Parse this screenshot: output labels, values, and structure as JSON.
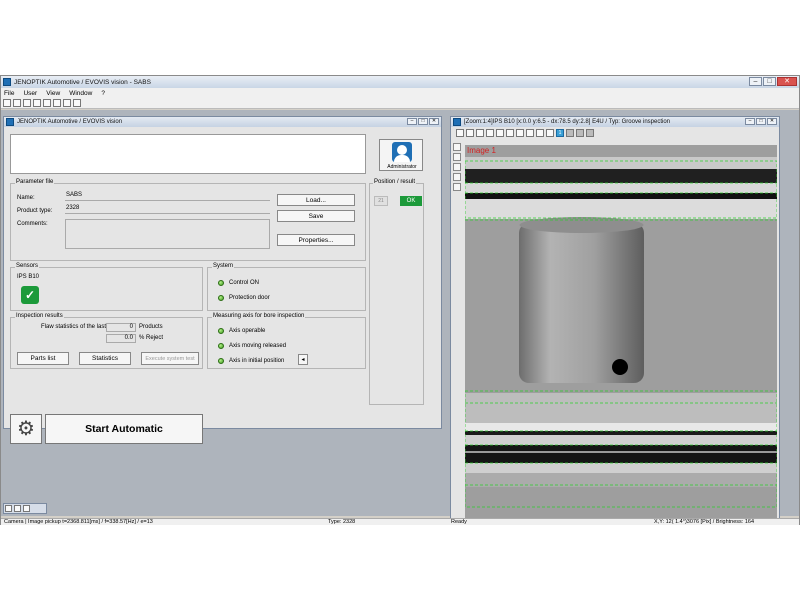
{
  "app": {
    "title": "JENOPTIK Automotive / EVOVIS vision - SABS"
  },
  "menu": [
    "File",
    "User",
    "View",
    "Window",
    "?"
  ],
  "main_window": {
    "title": "JENOPTIK Automotive / EVOVIS vision",
    "admin_label": "Administrator",
    "parameter_file": {
      "group_label": "Parameter file",
      "name_label": "Name:",
      "name_value": "SABS",
      "product_type_label": "Product type:",
      "product_type_value": "2328",
      "comments_label": "Comments:",
      "load_button": "Load...",
      "save_button": "Save",
      "properties_button": "Properties..."
    },
    "position_result": {
      "group_label": "Position / result",
      "position_value": "21",
      "result": "OK"
    },
    "sensors": {
      "group_label": "Sensors",
      "sensor_name": "IPS B10"
    },
    "system": {
      "group_label": "System",
      "items": [
        "Control ON",
        "Protection door"
      ]
    },
    "inspection_results": {
      "group_label": "Inspection results",
      "flaw_label": "Flaw statistics of the last",
      "products_value": "0",
      "products_label": "Products",
      "reject_value": "0.0",
      "reject_label": "% Reject",
      "parts_list_button": "Parts list",
      "statistics_button": "Statistics",
      "execute_system_test_button": "Execute system test"
    },
    "measuring_axis": {
      "group_label": "Measuring axis for bore inspection",
      "items": [
        "Axis operable",
        "Axis moving released",
        "Axis in initial position"
      ]
    },
    "start_button": "Start Automatic"
  },
  "image_window": {
    "title": "[Zoom:1:4]IPS B10  [x:0.0 y:6.5 - dx:78.5 dy:2.8]  E4U / Typ: Groove inspection",
    "image_label": "Image 1",
    "toolbar_selected": "1"
  },
  "status_bar": {
    "camera": "Camera | Image pickup t=2368.811[ms] / f=338.57[Hz] / e=13",
    "type": "Type: 2328",
    "state": "Ready",
    "coords": "X,Y:   12( 1.4°)3076 [Pix] / Brightness: 164"
  },
  "colors": {
    "ok_green": "#1c9a3a",
    "accent_blue": "#1f6fb5",
    "overlay_green": "#2dd02d",
    "image_title_red": "#d42020"
  }
}
